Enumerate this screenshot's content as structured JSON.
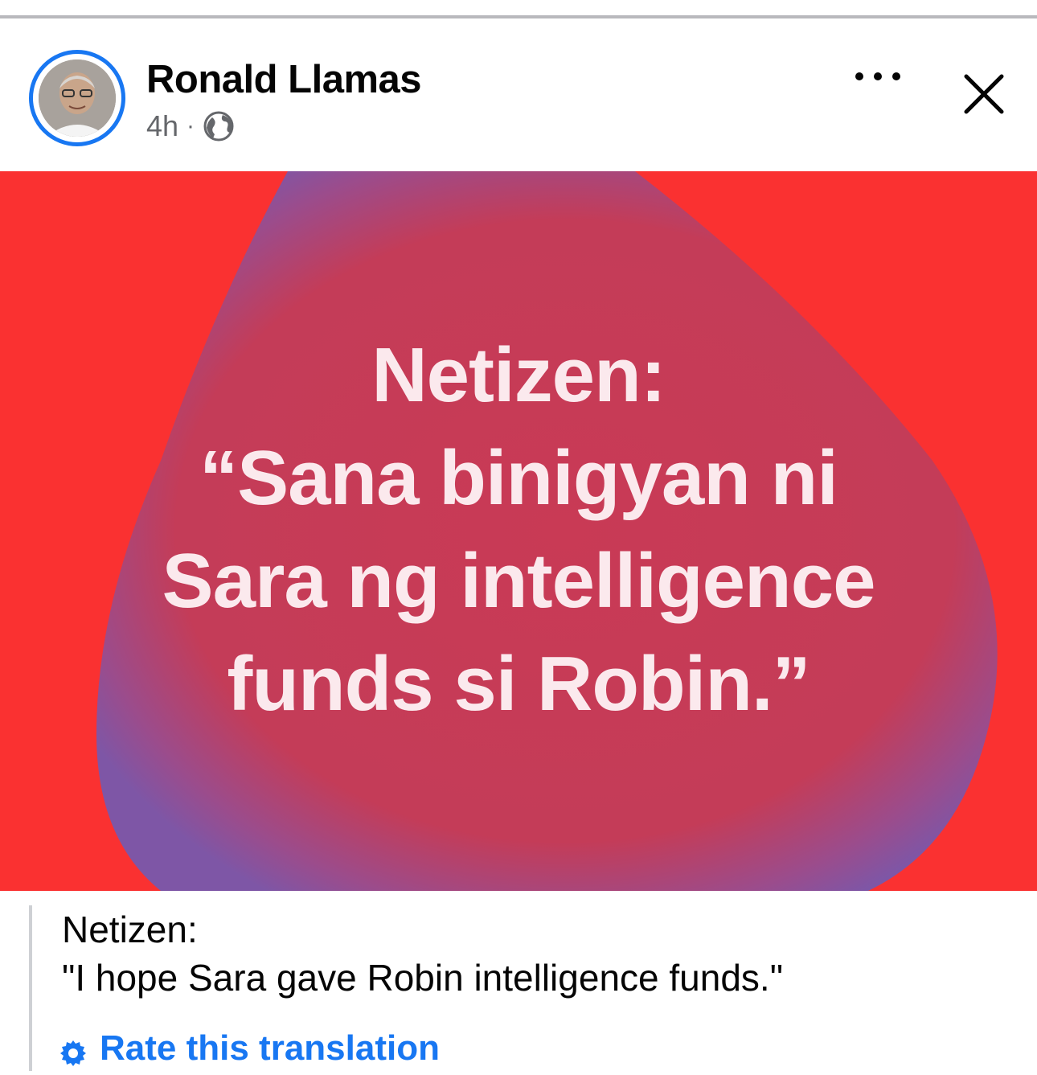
{
  "post": {
    "author": "Ronald Llamas",
    "time": "4h",
    "separator": "·",
    "privacy_icon": "globe-icon",
    "more_icon": "more-horizontal-icon",
    "close_icon": "close-icon"
  },
  "image": {
    "lines": [
      "Netizen:",
      "“Sana binigyan ni",
      "Sara ng intelligence",
      "funds si Robin.”"
    ],
    "colors": {
      "background": "#fa3131",
      "blob": "#c93a55",
      "text": "#fbe9ed"
    }
  },
  "translation": {
    "lines": [
      "Netizen:",
      "\"I hope Sara gave Robin intelligence funds.\""
    ],
    "rate_label": "Rate this translation"
  },
  "colors": {
    "accent": "#1877f2"
  }
}
